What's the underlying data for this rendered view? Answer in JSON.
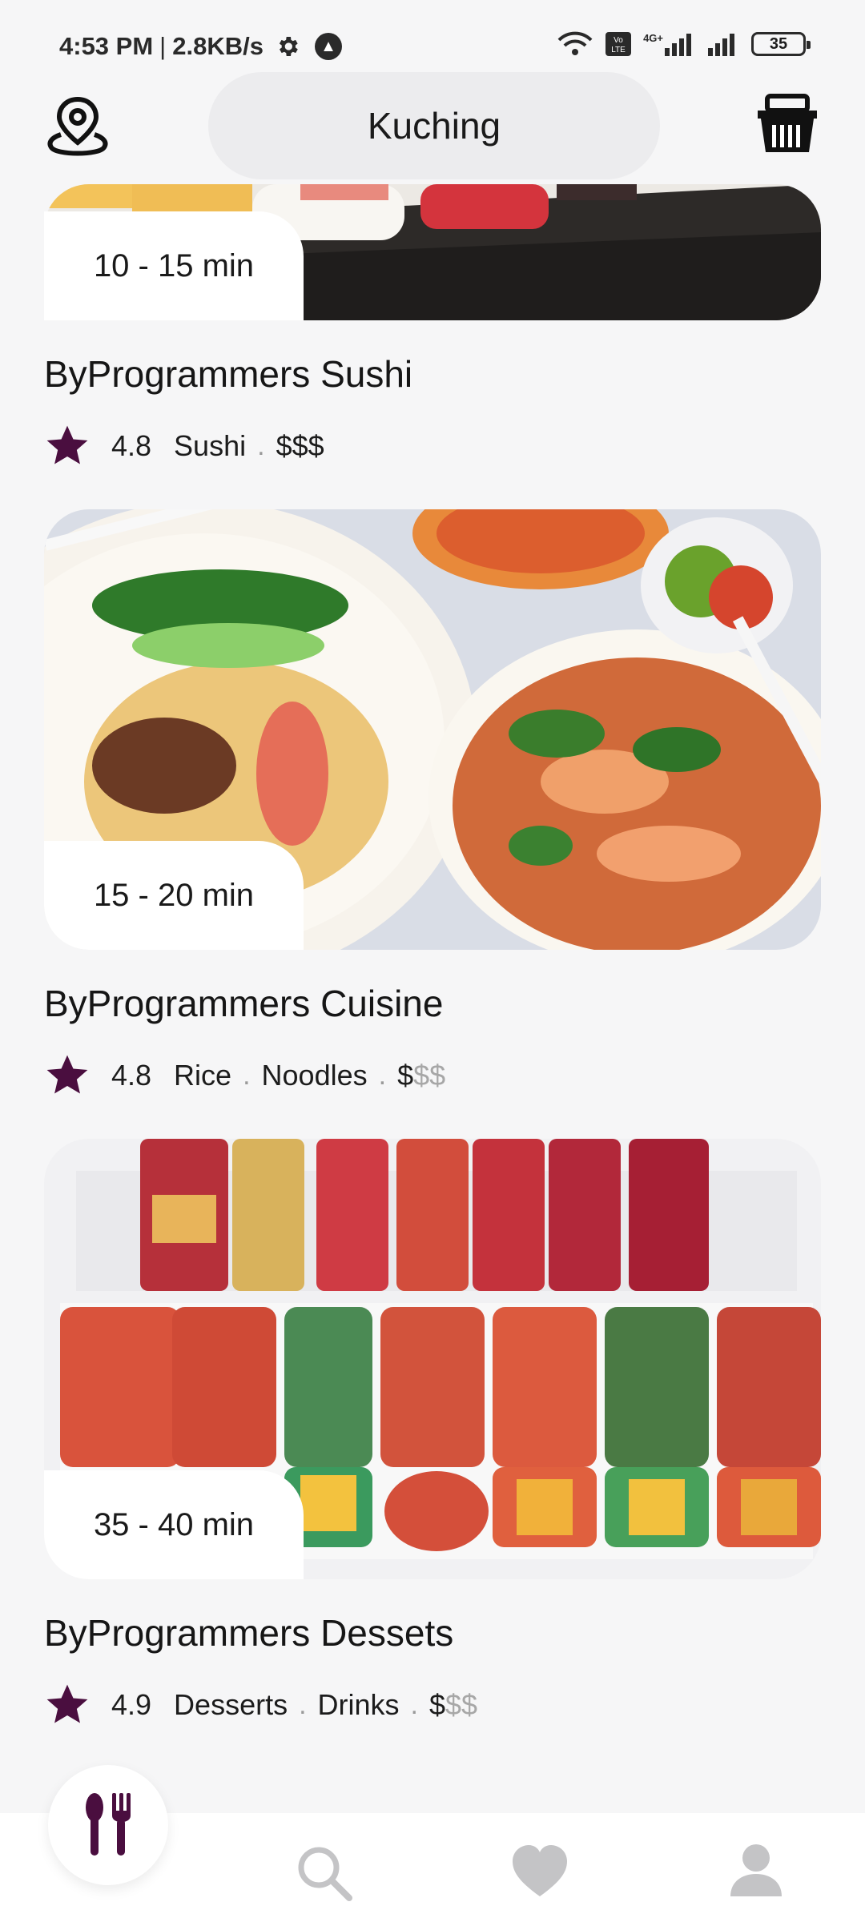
{
  "status_bar": {
    "time": "4:53 PM",
    "network_speed": "2.8KB/s",
    "battery": "35",
    "network_label": "4G+"
  },
  "header": {
    "location": "Kuching",
    "location_icon": "location-pin-icon",
    "cart_icon": "basket-icon"
  },
  "colors": {
    "accent": "#4a0e3f",
    "muted": "#a7a7a7",
    "background": "#f6f6f7"
  },
  "restaurants": [
    {
      "delivery_time": "10 - 15 min",
      "name": "ByProgrammers Sushi",
      "rating": "4.8",
      "categories": [
        "Sushi"
      ],
      "price_active": "$$$",
      "price_inactive": ""
    },
    {
      "delivery_time": "15 - 20 min",
      "name": "ByProgrammers Cuisine",
      "rating": "4.8",
      "categories": [
        "Rice",
        "Noodles"
      ],
      "price_active": "$",
      "price_inactive": "$$"
    },
    {
      "delivery_time": "35 - 40 min",
      "name": "ByProgrammers Dessets",
      "rating": "4.9",
      "categories": [
        "Desserts",
        "Drinks"
      ],
      "price_active": "$",
      "price_inactive": "$$"
    }
  ],
  "bottom_nav": {
    "items": [
      "restaurant-icon",
      "search-icon",
      "heart-icon",
      "profile-icon"
    ],
    "active": "restaurant-icon"
  }
}
